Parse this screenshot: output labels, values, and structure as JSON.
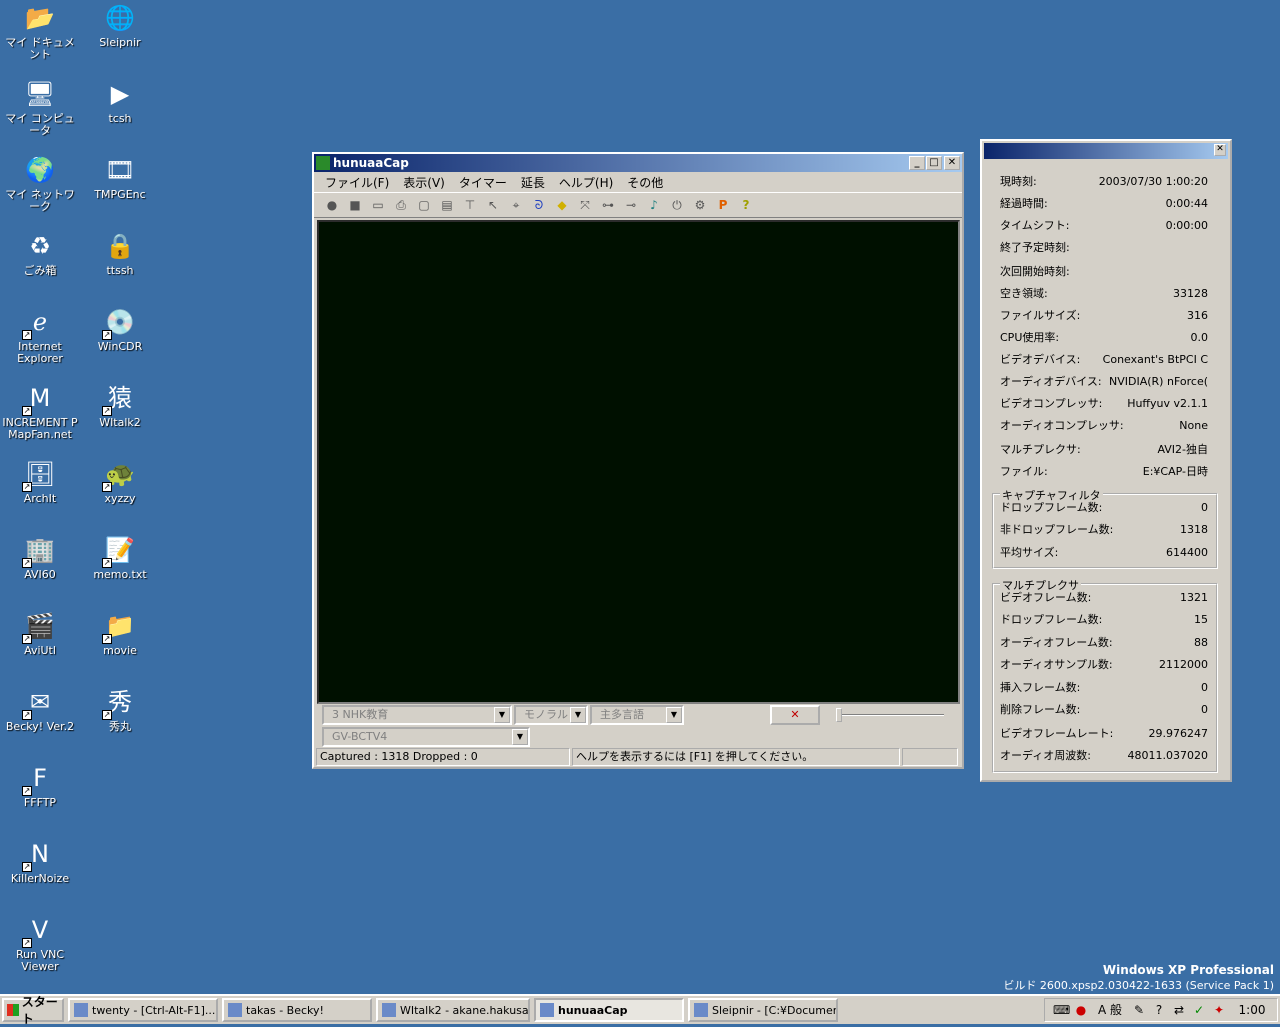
{
  "desktop": {
    "icons": [
      {
        "label": "マイ ドキュメント",
        "icon": "folder-docs-icon"
      },
      {
        "label": "Sleipnir",
        "icon": "browser-icon"
      },
      {
        "label": "マイ コンピュータ",
        "icon": "computer-icon"
      },
      {
        "label": "tcsh",
        "icon": "terminal-icon"
      },
      {
        "label": "マイ ネットワーク",
        "icon": "network-icon"
      },
      {
        "label": "TMPGEnc",
        "icon": "encoder-icon"
      },
      {
        "label": "ごみ箱",
        "icon": "recycle-bin-icon"
      },
      {
        "label": "ttssh",
        "icon": "lock-icon"
      },
      {
        "label": "Internet\nExplorer",
        "icon": "ie-icon"
      },
      {
        "label": "WinCDR",
        "icon": "cd-icon"
      },
      {
        "label": "INCREMENT P\nMapFan.net",
        "icon": "map-icon"
      },
      {
        "label": "WItalk2",
        "icon": "monkey-icon"
      },
      {
        "label": "ArchIt",
        "icon": "archive-icon"
      },
      {
        "label": "xyzzy",
        "icon": "turtle-icon"
      },
      {
        "label": "AVI60",
        "icon": "building-icon"
      },
      {
        "label": "memo.txt",
        "icon": "text-file-icon"
      },
      {
        "label": "AviUtl",
        "icon": "film-icon"
      },
      {
        "label": "movie",
        "icon": "folder-icon"
      },
      {
        "label": "Becky! Ver.2",
        "icon": "mail-icon"
      },
      {
        "label": "秀丸",
        "icon": "editor-icon"
      },
      {
        "label": "FFFTP",
        "icon": "ftp-icon"
      },
      {
        "label": "KillerNoize",
        "icon": "noise-icon"
      },
      {
        "label": "Run VNC\nViewer",
        "icon": "vnc-icon"
      }
    ],
    "os_title": "Windows XP Professional",
    "os_build": "ビルド 2600.xpsp2.030422-1633 (Service Pack 1)"
  },
  "capwin": {
    "title": "hunuaaCap",
    "menus": [
      "ファイル(F)",
      "表示(V)",
      "タイマー",
      "延長",
      "ヘルプ(H)",
      "その他"
    ],
    "channel": "3  NHK教育",
    "audio_mode": "モノラル",
    "language": "主多言語",
    "device": "GV-BCTV4",
    "status_left": "Captured : 1318   Dropped : 0",
    "status_right": "ヘルプを表示するには [F1] を押してください。"
  },
  "info": {
    "rows": [
      {
        "label": "現時刻:",
        "value": "2003/07/30 1:00:20"
      },
      {
        "label": "経過時間:",
        "value": "0:00:44"
      },
      {
        "label": "タイムシフト:",
        "value": "0:00:00"
      },
      {
        "label": "終了予定時刻:",
        "value": ""
      },
      {
        "label": "次回開始時刻:",
        "value": ""
      },
      {
        "label": "空き領域:",
        "value": "33128"
      },
      {
        "label": "ファイルサイズ:",
        "value": "316"
      },
      {
        "label": "CPU使用率:",
        "value": "0.0"
      },
      {
        "label": "ビデオデバイス:",
        "value": "Conexant's BtPCI C"
      },
      {
        "label": "オーディオデバイス:",
        "value": "NVIDIA(R) nForce("
      },
      {
        "label": "ビデオコンプレッサ:",
        "value": "Huffyuv v2.1.1"
      },
      {
        "label": "オーディオコンプレッサ:",
        "value": "None"
      },
      {
        "label": "マルチプレクサ:",
        "value": "AVI2-独自"
      },
      {
        "label": "ファイル:",
        "value": "E:¥CAP-日時"
      }
    ],
    "capture_filter": {
      "title": "キャプチャフィルタ",
      "rows": [
        {
          "label": "ドロップフレーム数:",
          "value": "0"
        },
        {
          "label": "非ドロップフレーム数:",
          "value": "1318"
        },
        {
          "label": "平均サイズ:",
          "value": "614400"
        }
      ]
    },
    "multiplexer": {
      "title": "マルチプレクサ",
      "rows": [
        {
          "label": "ビデオフレーム数:",
          "value": "1321"
        },
        {
          "label": "ドロップフレーム数:",
          "value": "15"
        },
        {
          "label": "オーディオフレーム数:",
          "value": "88"
        },
        {
          "label": "オーディオサンプル数:",
          "value": "2112000"
        },
        {
          "label": "挿入フレーム数:",
          "value": "0"
        },
        {
          "label": "削除フレーム数:",
          "value": "0"
        },
        {
          "label": "ビデオフレームレート:",
          "value": "29.976247"
        },
        {
          "label": "オーディオ周波数:",
          "value": "48011.037020"
        }
      ]
    }
  },
  "taskbar": {
    "start": "スタート",
    "tasks": [
      {
        "label": "twenty - [Ctrl-Alt-F1]...",
        "active": false
      },
      {
        "label": "takas - Becky!",
        "active": false
      },
      {
        "label": "WItalk2 - akane.hakusa...",
        "active": false
      },
      {
        "label": "hunuaaCap",
        "active": true
      },
      {
        "label": "Sleipnir - [C:¥Documen...",
        "active": false
      }
    ],
    "ime_mode": "A 般",
    "clock": "1:00"
  }
}
